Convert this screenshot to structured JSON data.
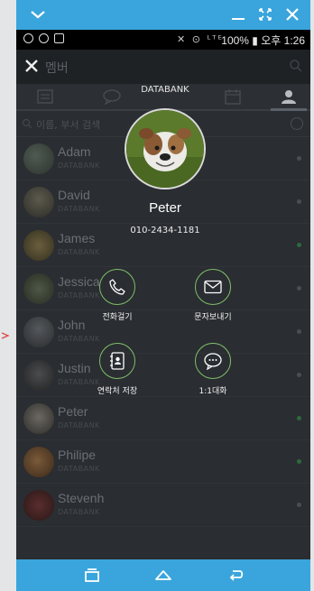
{
  "window": {
    "accent": "#3aa5dc"
  },
  "status": {
    "right": "100% ▮ 오후 1:26",
    "signal": "✕ ⊙ ᴸᵀᴱ"
  },
  "app_bar": {
    "title": "멤버"
  },
  "search": {
    "placeholder": "이름, 부서 검색"
  },
  "contacts": [
    {
      "name": "Adam",
      "org": "DATABANK"
    },
    {
      "name": "David",
      "org": "DATABANK"
    },
    {
      "name": "James",
      "org": "DATABANK"
    },
    {
      "name": "Jessica",
      "org": "DATABANK"
    },
    {
      "name": "John",
      "org": "DATABANK"
    },
    {
      "name": "Justin",
      "org": "DATABANK"
    },
    {
      "name": "Peter",
      "org": "DATABANK"
    },
    {
      "name": "Philipe",
      "org": "DATABANK"
    },
    {
      "name": "Stevenh",
      "org": "DATABANK"
    }
  ],
  "profile": {
    "company": "DATABANK",
    "name": "Peter",
    "phone": "010-2434-1181",
    "actions": [
      {
        "label": "전화걸기",
        "icon": "phone-icon"
      },
      {
        "label": "문자보내기",
        "icon": "mail-icon"
      },
      {
        "label": "연락처 저장",
        "icon": "address-book-icon"
      },
      {
        "label": "1:1대화",
        "icon": "chat-bubble-icon"
      }
    ]
  }
}
